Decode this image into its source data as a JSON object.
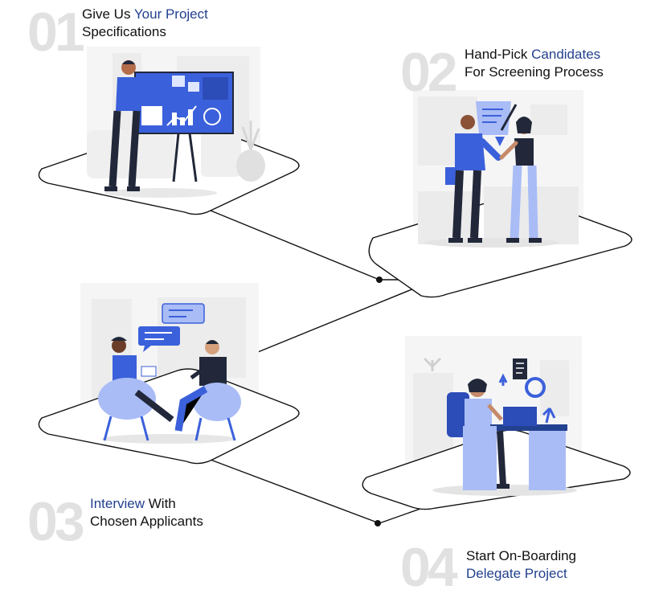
{
  "colors": {
    "accent_text": "#22418f",
    "illustration_blue": "#4a6fe3",
    "illustration_light_blue": "#a9bcf6",
    "dark_navy": "#22283a",
    "number_gray": "#e1e1e1",
    "outline": "#111111"
  },
  "steps": [
    {
      "number": "01",
      "line1_prefix": "Give Us ",
      "line1_accent": "Your Project",
      "line2_prefix": "",
      "line2_accent": "",
      "line2_text": "Specifications",
      "illustration": "presentation-board-icon"
    },
    {
      "number": "02",
      "line1_prefix": "Hand-Pick ",
      "line1_accent": "Candidates",
      "line2_prefix": "",
      "line2_accent": "",
      "line2_text": "For Screening Process",
      "illustration": "handshake-icon"
    },
    {
      "number": "03",
      "line1_prefix": "",
      "line1_accent": "Interview",
      "line1_suffix": " With",
      "line2_text": "Chosen Applicants",
      "illustration": "interview-chat-icon"
    },
    {
      "number": "04",
      "line1_prefix": "Start On-Boarding",
      "line1_accent": "",
      "line2_accent": "Delegate Project",
      "illustration": "desk-onboarding-icon"
    }
  ]
}
